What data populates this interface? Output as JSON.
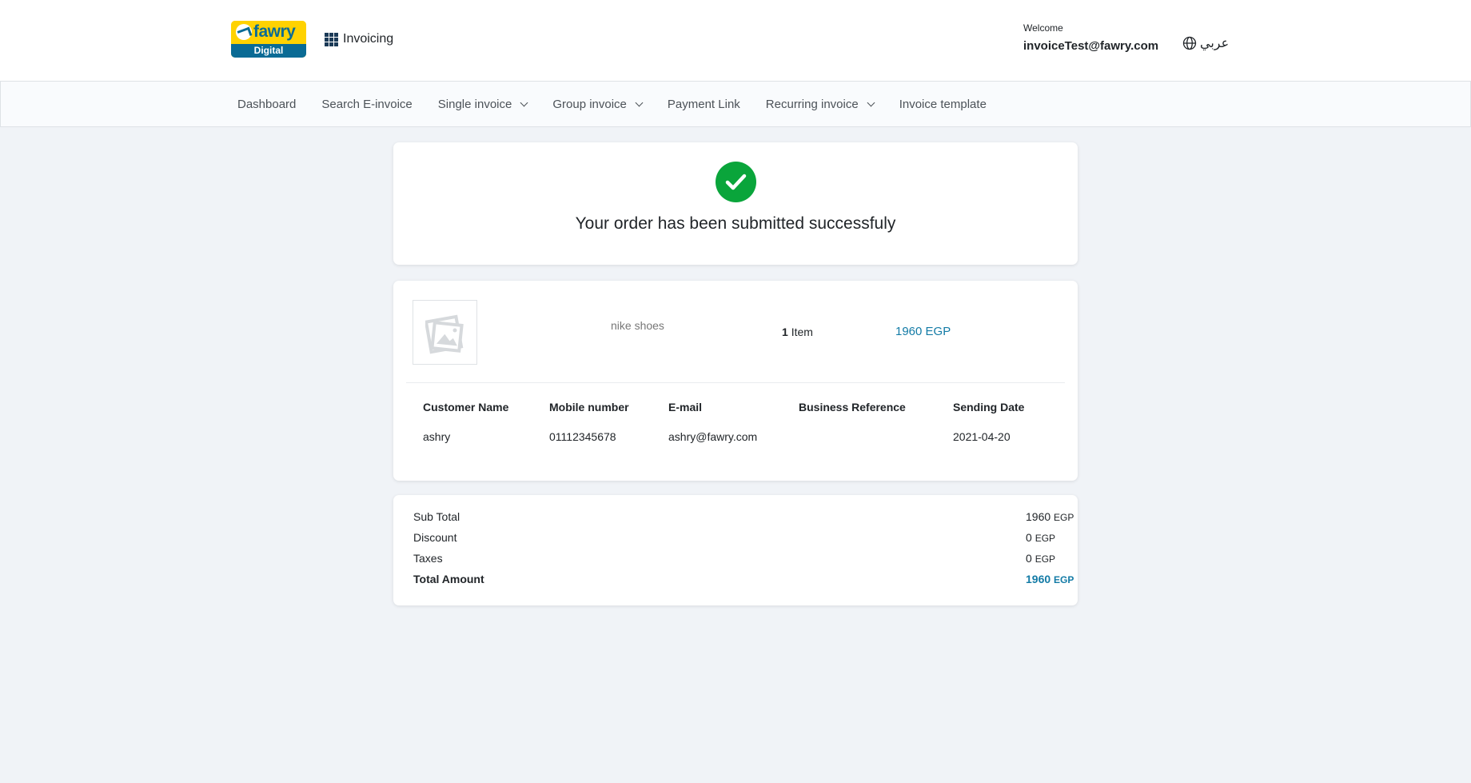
{
  "header": {
    "logo": {
      "word": "fawry",
      "sub": "Digital"
    },
    "app_switcher": {
      "icon": "grid-icon",
      "label": "Invoicing"
    },
    "welcome_label": "Welcome",
    "user_email": "invoiceTest@fawry.com",
    "language": {
      "icon": "globe-icon",
      "label": "عربي"
    }
  },
  "nav": {
    "items": [
      {
        "label": "Dashboard",
        "dropdown": false
      },
      {
        "label": "Search E-invoice",
        "dropdown": false
      },
      {
        "label": "Single invoice",
        "dropdown": true
      },
      {
        "label": "Group invoice",
        "dropdown": true
      },
      {
        "label": "Payment Link",
        "dropdown": false
      },
      {
        "label": "Recurring invoice",
        "dropdown": true
      },
      {
        "label": "Invoice template",
        "dropdown": false
      }
    ]
  },
  "success": {
    "icon": "check-circle-icon",
    "message": "Your order has been submitted successfuly"
  },
  "item": {
    "image_icon": "image-placeholder-icon",
    "name": "nike shoes",
    "quantity": "1",
    "quantity_unit": "Item",
    "price": "1960 EGP"
  },
  "details": {
    "columns": [
      {
        "header": "Customer Name",
        "value": "ashry"
      },
      {
        "header": "Mobile number",
        "value": "01112345678"
      },
      {
        "header": "E-mail",
        "value": "ashry@fawry.com"
      },
      {
        "header": "Business Reference",
        "value": ""
      },
      {
        "header": "Sending Date",
        "value": "2021-04-20"
      }
    ]
  },
  "totals": {
    "rows": [
      {
        "label": "Sub Total",
        "amount": "1960",
        "currency": "EGP"
      },
      {
        "label": "Discount",
        "amount": "0",
        "currency": "EGP"
      },
      {
        "label": "Taxes",
        "amount": "0",
        "currency": "EGP"
      },
      {
        "label": "Total Amount",
        "amount": "1960",
        "currency": "EGP"
      }
    ]
  },
  "colors": {
    "accent": "#137ba6",
    "success": "#0aa53b",
    "brand_yellow": "#ffd200",
    "brand_blue": "#0a6b95",
    "page_background": "#f0f3f7"
  }
}
